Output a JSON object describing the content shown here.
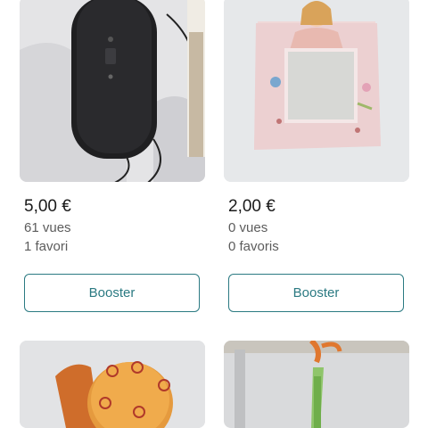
{
  "listings": [
    {
      "price": "5,00 €",
      "views": "61 vues",
      "favorites": "1 favori",
      "action_label": "Booster",
      "image": "speaker-photo"
    },
    {
      "price": "2,00 €",
      "views": "0 vues",
      "favorites": "0 favoris",
      "action_label": "Booster",
      "image": "photo-frame-photo"
    },
    {
      "image": "mushroom-lamp-photo"
    },
    {
      "image": "hanging-toy-photo"
    }
  ],
  "colors": {
    "accent": "#2b7a82",
    "text": "#1a1a1a",
    "muted": "#5c5c5c"
  }
}
